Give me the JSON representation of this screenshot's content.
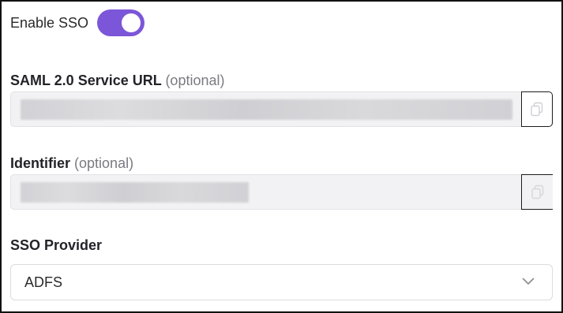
{
  "sso_toggle": {
    "label": "Enable SSO",
    "enabled": true,
    "accent_color": "#7c56d8"
  },
  "saml_url": {
    "label": "SAML 2.0 Service URL",
    "optional_hint": "(optional)",
    "value_blurred": true,
    "copy_icon": "copy-icon"
  },
  "identifier": {
    "label": "Identifier",
    "optional_hint": "(optional)",
    "value_blurred": true,
    "copy_icon": "copy-icon"
  },
  "sso_provider": {
    "label": "SSO Provider",
    "selected": "ADFS",
    "dropdown_icon": "chevron-down-icon"
  }
}
